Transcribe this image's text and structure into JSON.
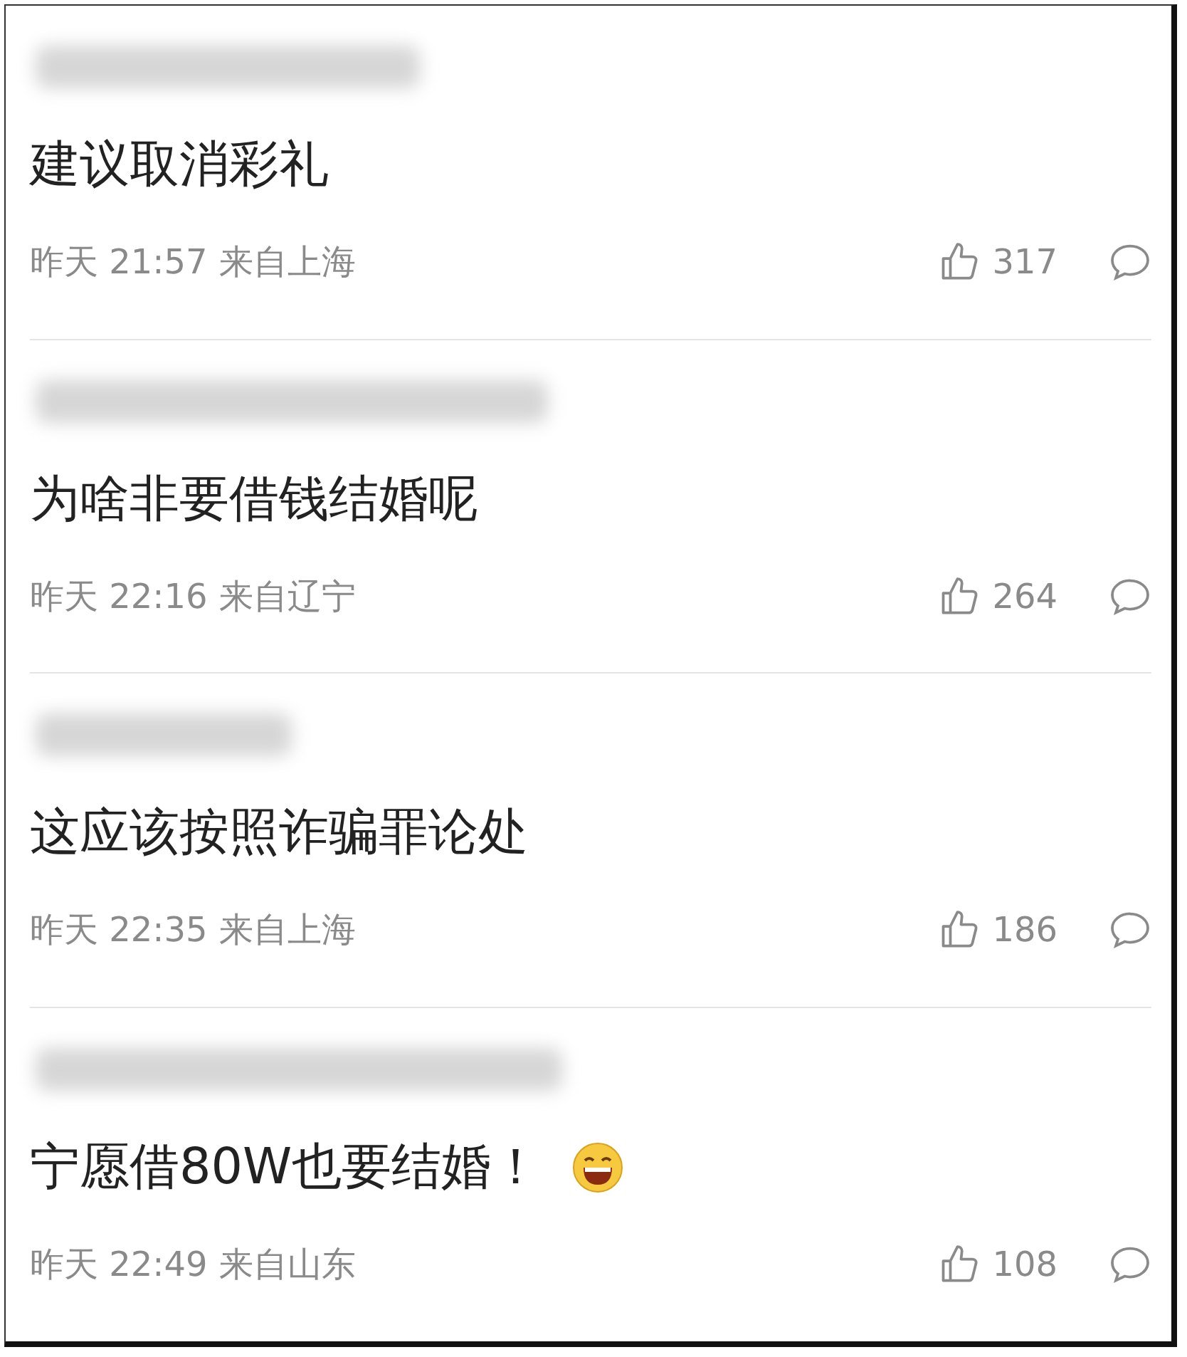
{
  "comments": [
    {
      "text": "建议取消彩礼",
      "time": "昨天 21:57",
      "location": "来自上海",
      "likes": "317",
      "emoji": false
    },
    {
      "text": "为啥非要借钱结婚呢",
      "time": "昨天 22:16",
      "location": "来自辽宁",
      "likes": "264",
      "emoji": false
    },
    {
      "text": "这应该按照诈骗罪论处",
      "time": "昨天 22:35",
      "location": "来自上海",
      "likes": "186",
      "emoji": false
    },
    {
      "text": "宁愿借80W也要结婚！",
      "time": "昨天 22:49",
      "location": "来自山东",
      "likes": "108",
      "emoji": true
    }
  ]
}
